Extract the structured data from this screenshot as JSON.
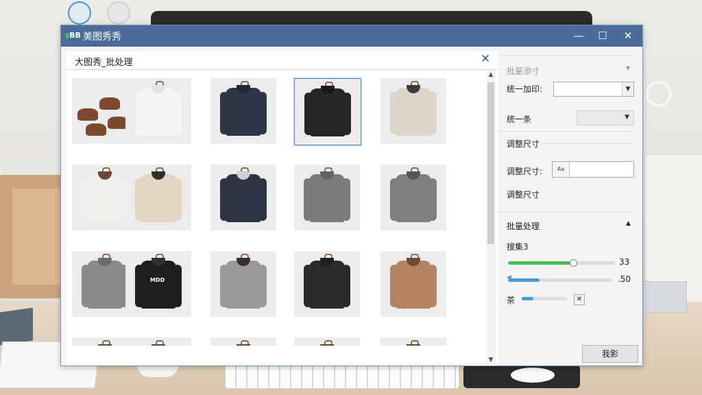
{
  "window": {
    "title": "美图秀秀",
    "logo_text": "BB",
    "minimize_glyph": "—",
    "maximize_glyph": "☐",
    "close_glyph": "✕"
  },
  "batch_panel": {
    "title": "大图秀_批处理",
    "close_glyph": "✕",
    "thumbnails": [
      {
        "kind": "shoes",
        "color": "#7b4a2d"
      },
      {
        "kind": "jacket",
        "color": "#f5f5f3",
        "collar": "#e2e2e2"
      },
      {
        "kind": "jacket",
        "color": "#2e3544",
        "collar": "#222833"
      },
      {
        "kind": "jacket",
        "color": "#262626",
        "collar": "#1a1a1a",
        "selected": true
      },
      {
        "kind": "jacket",
        "color": "#ddd6c8",
        "collar": "#3b3b3b"
      },
      {
        "kind": "jacket",
        "color": "#f0efeb",
        "collar": "#6b4a35"
      },
      {
        "kind": "jacket",
        "color": "#e2d6c2",
        "collar": "#2f2f2f"
      },
      {
        "kind": "jacket",
        "color": "#2e3443",
        "collar": "#cfcfcf"
      },
      {
        "kind": "jacket",
        "color": "#7b7b7b",
        "collar": "#616161"
      },
      {
        "kind": "jacket",
        "color": "#7f7f7f",
        "collar": "#555555"
      },
      {
        "kind": "jacket",
        "color": "#8a8a8a",
        "collar": "#6a6a6a"
      },
      {
        "kind": "jacket",
        "color": "#1e1e1e",
        "collar": "#303030",
        "print": "MDD"
      },
      {
        "kind": "jacket",
        "color": "#9a9a9a",
        "collar": "#3a2f2a"
      },
      {
        "kind": "jacket",
        "color": "#2b2b2b",
        "collar": "#1f1f1f"
      },
      {
        "kind": "jacket",
        "color": "#b48462",
        "collar": "#6e4a33"
      }
    ]
  },
  "settings": {
    "section_batch_name": "批量添寸",
    "section_batch_name_arrow": "▼",
    "watermark_label": "统一加印:",
    "watermark_value": "",
    "dropdown_glyph": "▼",
    "uniform_label": "统一条",
    "uniform_value": "",
    "resize_header": "调整尺寸",
    "resize_label": "调整尺寸:",
    "resize_button_text": "Aa",
    "resize_value": "",
    "resize_sub": "调整尺寸",
    "batch_process_header": "批量处理",
    "collapse_glyph": "▲",
    "option_label": "搜集3",
    "slider1_value": "33",
    "slider2_value": ".50",
    "slider3_label": "茶",
    "slider3_clear": "✕",
    "sliders": [
      {
        "fill": 0.6,
        "color": "#4cbf58"
      },
      {
        "fill": 0.3,
        "color": "#4b9ad8"
      },
      {
        "fill": 0.25,
        "color": "#4b9ad8"
      }
    ],
    "action_button": "我影"
  }
}
